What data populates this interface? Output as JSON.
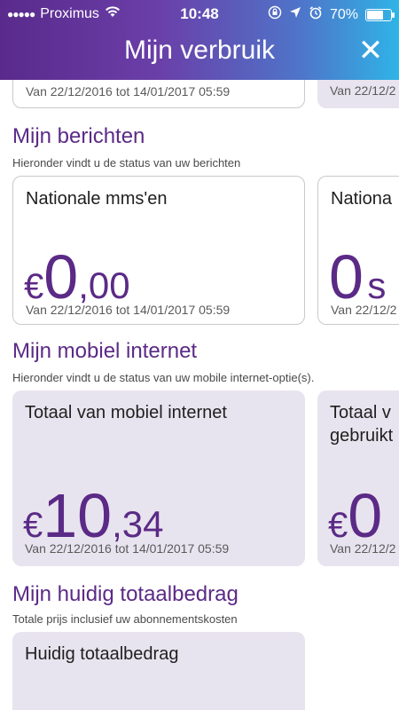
{
  "status_bar": {
    "signal_dots": "●●●●●",
    "carrier": "Proximus",
    "wifi_icon": "wifi-icon",
    "time": "10:48",
    "battery_percent": "70%",
    "battery_level": 0.7
  },
  "header": {
    "title": "Mijn verbruik",
    "close_symbol": "✕"
  },
  "top_row": {
    "period_left": "Van 22/12/2016 tot 14/01/2017 05:59",
    "period_right": "Van 22/12/2"
  },
  "berichten": {
    "heading": "Mijn berichten",
    "subtitle": "Hieronder vindt u de status van uw berichten",
    "card1": {
      "title": "Nationale mms'en",
      "currency": "€",
      "whole": "0",
      "decimal": ",00",
      "period": "Van 22/12/2016 tot 14/01/2017 05:59"
    },
    "card2": {
      "title": "Nationa",
      "value": "0",
      "unit": "s",
      "period": "Van 22/12/2"
    }
  },
  "internet": {
    "heading": "Mijn mobiel internet",
    "subtitle": "Hieronder vindt u de status van uw mobile internet-optie(s).",
    "card1": {
      "title": "Totaal van mobiel internet",
      "currency": "€",
      "whole": "10",
      "decimal": ",34",
      "period": "Van 22/12/2016 tot 14/01/2017 05:59"
    },
    "card2": {
      "title_line1": "Totaal v",
      "title_line2": "gebruikt",
      "currency": "€",
      "whole": "0",
      "period": "Van 22/12/2"
    }
  },
  "totaal": {
    "heading": "Mijn huidig totaalbedrag",
    "subtitle": "Totale prijs inclusief uw abonnementskosten",
    "card1": {
      "title": "Huidig totaalbedrag"
    }
  }
}
